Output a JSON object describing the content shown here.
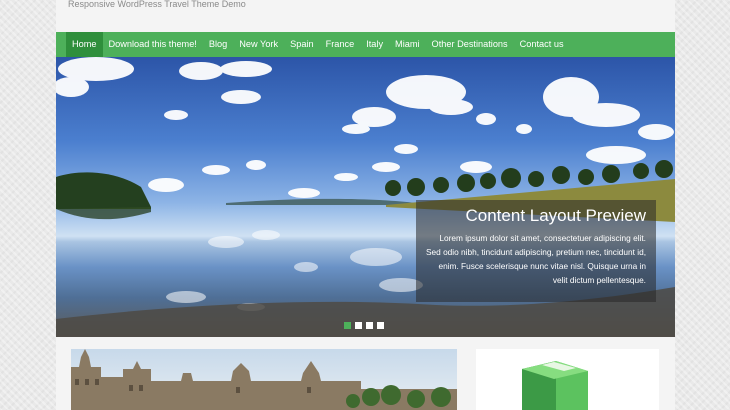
{
  "site": {
    "tagline": "Responsive WordPress Travel Theme Demo"
  },
  "nav": {
    "items": [
      {
        "label": "Home",
        "active": true
      },
      {
        "label": "Download this theme!"
      },
      {
        "label": "Blog"
      },
      {
        "label": "New York"
      },
      {
        "label": "Spain"
      },
      {
        "label": "France"
      },
      {
        "label": "Italy"
      },
      {
        "label": "Miami"
      },
      {
        "label": "Other Destinations"
      },
      {
        "label": "Contact us"
      }
    ]
  },
  "slider": {
    "caption_title": "Content Layout Preview",
    "caption_text": "Lorem ipsum dolor sit amet, consectetuer adipiscing elit. Sed odio nibh, tincidunt adipiscing, pretium nec, tincidunt id, enim. Fusce scelerisque nunc vitae nisl. Quisque urna in velit dictum pellentesque.",
    "slides_total": 4,
    "current_slide": 1
  },
  "colors": {
    "accent": "#4db05a",
    "nav_active": "#2f8f3c"
  }
}
